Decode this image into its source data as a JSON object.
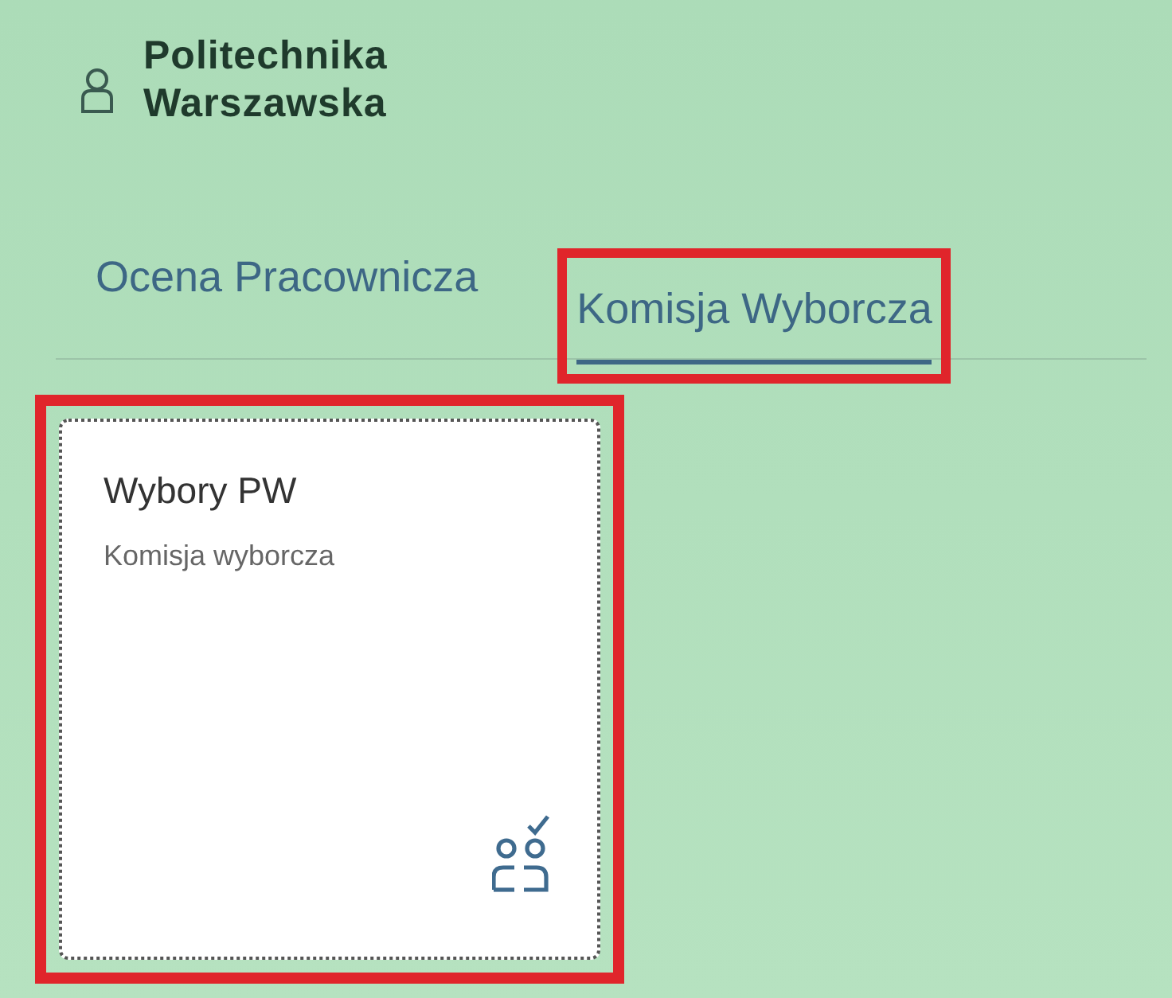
{
  "header": {
    "logo_lines": [
      "Politechnika",
      "Warszawska"
    ]
  },
  "tabs": [
    {
      "label": "Ocena Pracownicza",
      "selected": false,
      "highlighted": false
    },
    {
      "label": "Komisja Wyborcza",
      "selected": true,
      "highlighted": true
    }
  ],
  "tiles": [
    {
      "title": "Wybory PW",
      "subtitle": "Komisja wyborcza",
      "highlighted": true
    }
  ]
}
